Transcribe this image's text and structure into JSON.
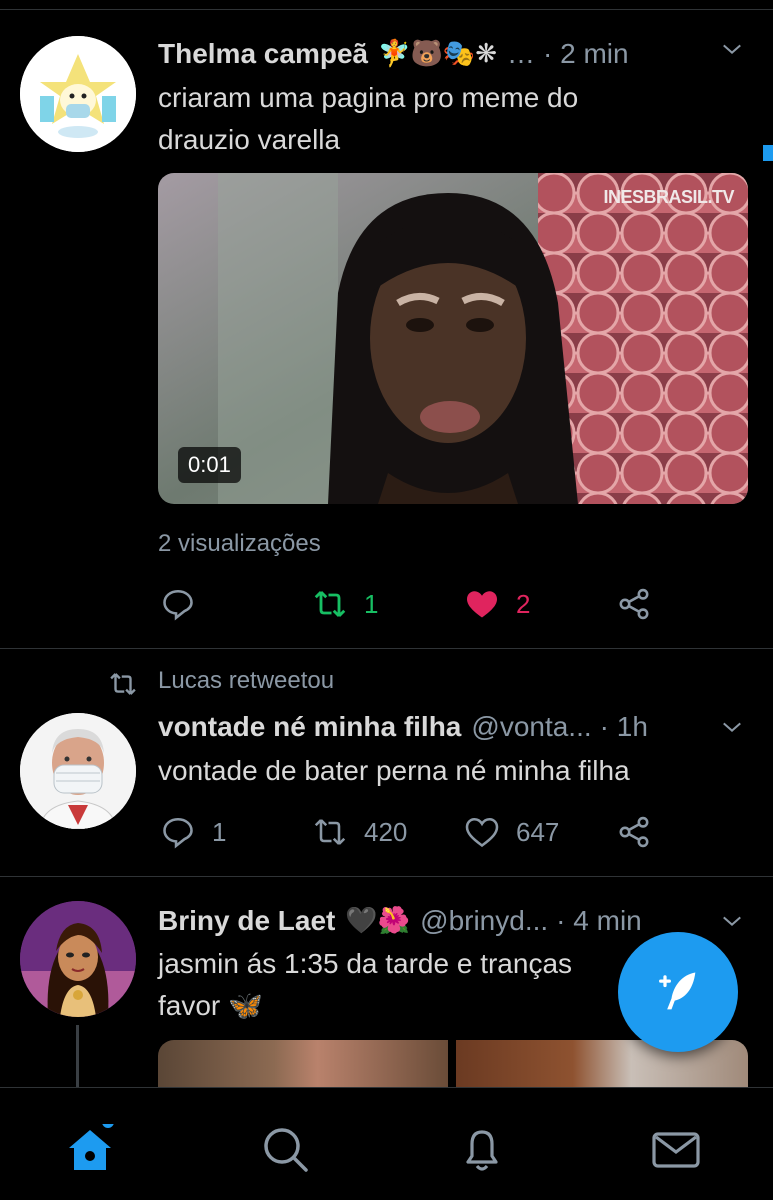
{
  "tweets": [
    {
      "name": "Thelma campeã",
      "name_emojis": "🧚🐻🎭❋",
      "ellipsis": "…",
      "time": "· 2 min",
      "text_line1": "criaram uma pagina pro meme do",
      "text_line2": "drauzio varella",
      "video": {
        "watermark": "INESBRASIL.TV",
        "duration": "0:01"
      },
      "views": "2 visualizações",
      "retweets": "1",
      "likes": "2"
    },
    {
      "retweet_label": "Lucas retweetou",
      "name": "vontade né minha filha",
      "handle": "@vonta...",
      "time": "· 1h",
      "text": "vontade de bater perna né minha filha",
      "replies": "1",
      "retweets": "420",
      "likes": "647"
    },
    {
      "name": "Briny de Laet",
      "name_emojis": "🖤🌺",
      "handle": "@brinyd...",
      "time": "· 4 min",
      "text_line1": "jasmin ás 1:35 da tarde e tranças",
      "text_line2": "favor 🦋"
    }
  ],
  "colors": {
    "background": "#000000",
    "accent": "#1d9bf0",
    "retweet_green": "#17bf63",
    "like_pink": "#e0245e",
    "secondary_text": "#8b98a5"
  },
  "icons": {
    "reply": "reply-icon",
    "retweet": "retweet-icon",
    "like": "heart-icon",
    "share": "share-icon",
    "home": "home-icon",
    "search": "search-icon",
    "notifications": "bell-icon",
    "messages": "mail-icon",
    "compose": "compose-tweet-icon"
  }
}
